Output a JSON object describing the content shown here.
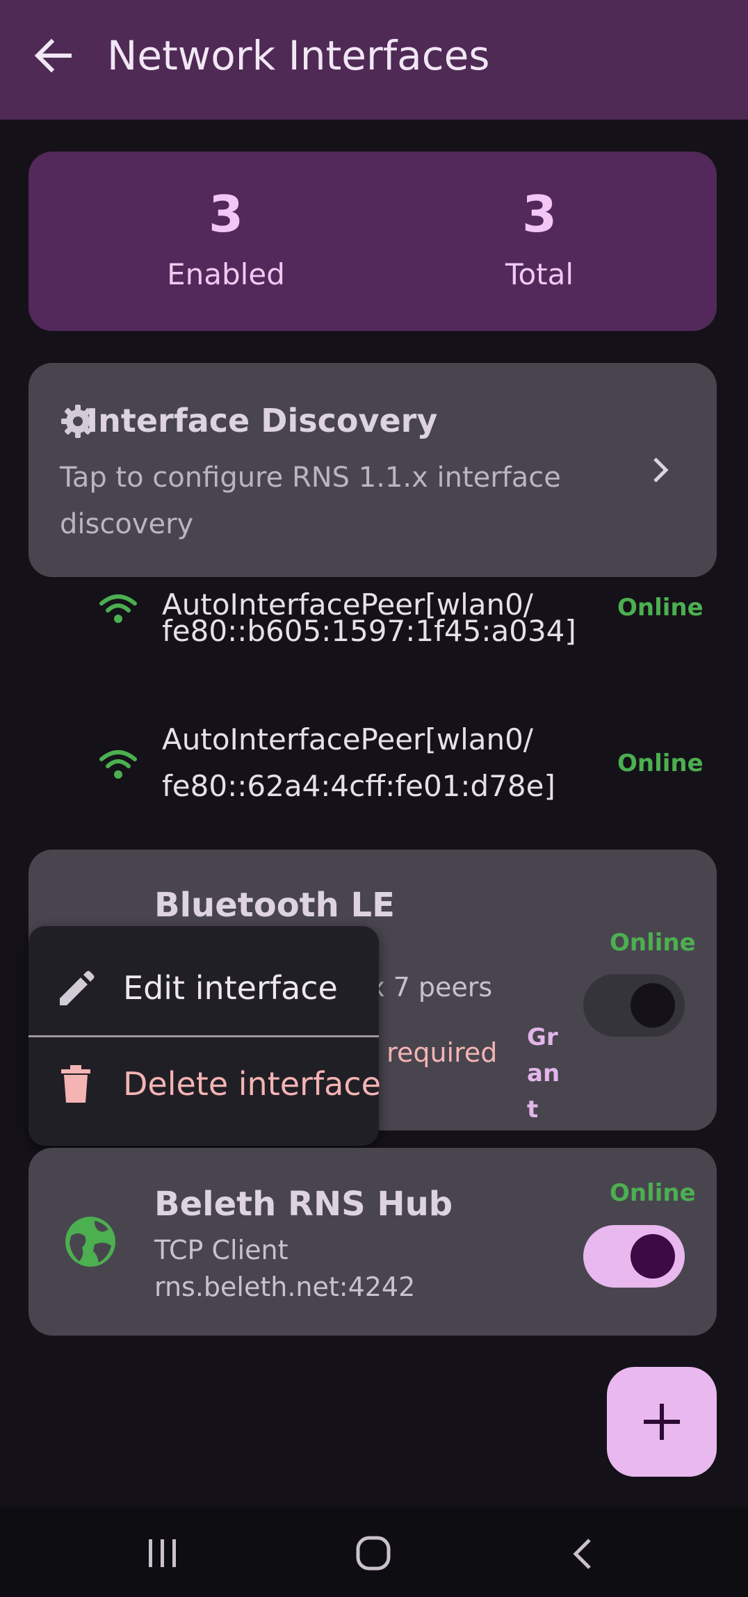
{
  "app_bar": {
    "title": "Network Interfaces",
    "back_icon": "arrow-left-icon"
  },
  "stats": {
    "enabled_count": "3",
    "enabled_label": "Enabled",
    "total_count": "3",
    "total_label": "Total"
  },
  "discovery": {
    "icon": "gear-icon",
    "title": "Interface Discovery",
    "subtitle": "Tap to configure RNS 1.1.x interface discovery",
    "chevron_icon": "chevron-right-icon"
  },
  "peers": [
    {
      "line1": "AutoInterfacePeer[wlan0/",
      "line2": "fe80::b605:1597:1f45:a034]",
      "status": "Online"
    },
    {
      "line1": "AutoInterfacePeer[wlan0/",
      "line2": "fe80::62a4:4cff:fe01:d78e]",
      "status": "Online"
    }
  ],
  "bluetooth_card": {
    "title": "Bluetooth LE",
    "detail_fragment": "d' · max 7 peers",
    "warning_fragment": "n required",
    "grant_label": "Grant",
    "status": "Online",
    "enabled": false
  },
  "hub_card": {
    "title": "Beleth RNS Hub",
    "type": "TCP Client",
    "address": "rns.beleth.net:4242",
    "status": "Online",
    "enabled": true,
    "icon": "globe-icon"
  },
  "context_menu": {
    "edit_label": "Edit interface",
    "delete_label": "Delete interface",
    "edit_icon": "pencil-icon",
    "delete_icon": "trash-icon"
  },
  "fab": {
    "icon": "plus-icon"
  },
  "colors": {
    "primary": "#e8b8ef",
    "online": "#4caf50",
    "appbar": "#4f2a55",
    "danger": "#f4b4b4"
  }
}
